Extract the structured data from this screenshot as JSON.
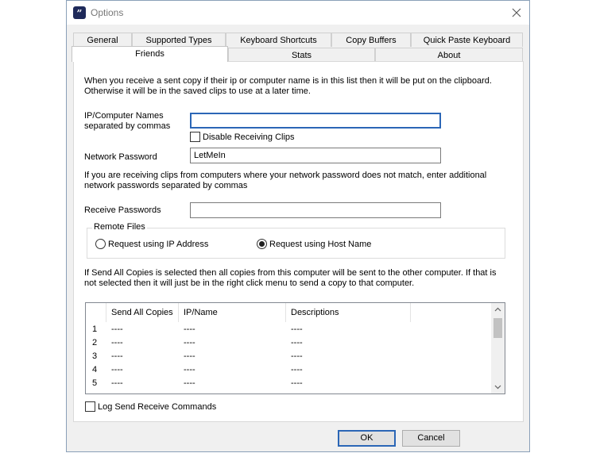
{
  "window": {
    "title": "Options",
    "app_icon_glyph": "”"
  },
  "tabs_back": [
    {
      "label": "General"
    },
    {
      "label": "Supported Types"
    },
    {
      "label": "Keyboard Shortcuts"
    },
    {
      "label": "Copy Buffers"
    },
    {
      "label": "Quick Paste Keyboard"
    }
  ],
  "tabs_front": [
    {
      "label": "Friends",
      "active": true
    },
    {
      "label": "Stats"
    },
    {
      "label": "About"
    }
  ],
  "friends": {
    "intro_line1": "When you receive a sent copy if their ip or computer name is in this list then it will be put on the clipboard.",
    "intro_line2": "Otherwise it will be in the saved clips to use at a later time.",
    "ip_label_line1": "IP/Computer Names",
    "ip_label_line2": "separated by commas",
    "ip_value": "",
    "disable_receiving_label": "Disable Receiving Clips",
    "disable_receiving_checked": false,
    "network_password_label": "Network Password",
    "network_password_value": "LetMeIn",
    "passwords_note_line1": "If you are receiving clips from computers where your network password does not match, enter additional",
    "passwords_note_line2": "network passwords separated by commas",
    "receive_passwords_label": "Receive Passwords",
    "receive_passwords_value": "",
    "remote_files": {
      "legend": "Remote Files",
      "option_ip": "Request using IP Address",
      "option_host": "Request using Host Name",
      "selected": "host"
    },
    "send_note_line1": "If Send All Copies is selected then all copies from this computer will be sent to the other computer.  If that is",
    "send_note_line2": "not selected then it will just be in the right click menu to send a copy to that computer.",
    "table": {
      "columns": [
        "Send All Copies",
        "IP/Name",
        "Descriptions"
      ],
      "rows": [
        {
          "num": "1",
          "send": "----",
          "ip": "----",
          "desc": "----"
        },
        {
          "num": "2",
          "send": "----",
          "ip": "----",
          "desc": "----"
        },
        {
          "num": "3",
          "send": "----",
          "ip": "----",
          "desc": "----"
        },
        {
          "num": "4",
          "send": "----",
          "ip": "----",
          "desc": "----"
        },
        {
          "num": "5",
          "send": "----",
          "ip": "----",
          "desc": "----"
        }
      ]
    },
    "log_label": "Log Send Receive Commands",
    "log_checked": false
  },
  "buttons": {
    "ok": "OK",
    "cancel": "Cancel"
  },
  "colors": {
    "accent": "#2b66b6",
    "app_icon_bg": "#1f2a5a"
  }
}
